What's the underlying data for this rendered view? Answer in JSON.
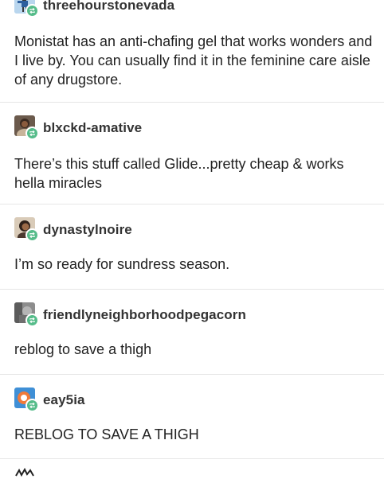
{
  "colors": {
    "reblog_badge": "#56bc8a",
    "divider": "#e6e6e6",
    "text": "#222222"
  },
  "posts": [
    {
      "username": "threehourstonevada",
      "avatar_icon": "pixel-figure-avatar",
      "body": "Monistat has an anti-chafing gel that works wonders and I live by. You can usually find it in the feminine care aisle of any drugstore."
    },
    {
      "username": "blxckd-amative",
      "avatar_icon": "portrait-photo-avatar",
      "body": "There’s this stuff called Glide...pretty cheap & works hella miracles"
    },
    {
      "username": "dynastylnoire",
      "avatar_icon": "portrait-photo-avatar",
      "body": "I’m so ready for sundress season."
    },
    {
      "username": "friendlyneighborhoodpegacorn",
      "avatar_icon": "grey-photo-avatar",
      "body": "reblog to save a thigh"
    },
    {
      "username": "eay5ia",
      "avatar_icon": "blue-orange-logo-avatar",
      "body": "REBLOG TO SAVE A THIGH"
    }
  ]
}
